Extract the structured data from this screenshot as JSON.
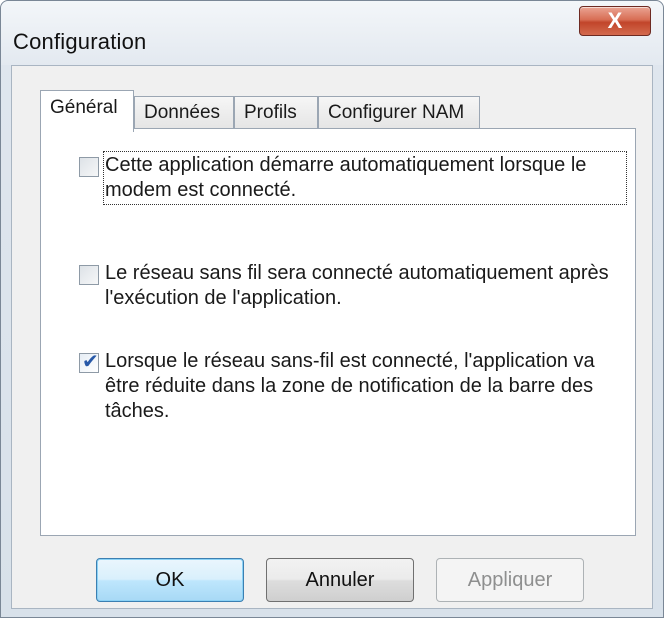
{
  "window": {
    "title": "Configuration",
    "close_glyph": "X"
  },
  "tabs": [
    {
      "label": "Général",
      "active": true
    },
    {
      "label": "Données",
      "active": false
    },
    {
      "label": "Profils",
      "active": false
    },
    {
      "label": "Configurer NAM",
      "active": false
    }
  ],
  "options": [
    {
      "label": "Cette application démarre automatiquement lorsque le modem est connecté.",
      "checked": false
    },
    {
      "label": "Le réseau sans fil sera connecté automatiquement après l'exécution de l'application.",
      "checked": false
    },
    {
      "label": "Lorsque le réseau sans-fil est connecté, l'application va être réduite dans la zone de notification de la barre des tâches.",
      "checked": true
    }
  ],
  "buttons": {
    "ok": "OK",
    "cancel": "Annuler",
    "apply": "Appliquer"
  },
  "check_glyph": "✔",
  "colors": {
    "close_button": "#c1452a",
    "default_button": "#bee6fd",
    "check_mark": "#2859a8"
  }
}
